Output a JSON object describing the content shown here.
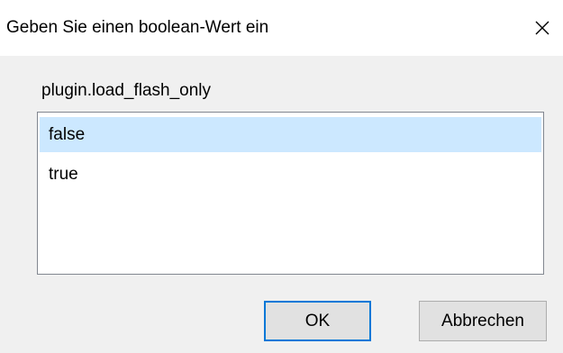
{
  "window": {
    "title": "Geben Sie einen boolean-Wert ein",
    "close_icon": "close-icon"
  },
  "prompt": {
    "label": "plugin.load_flash_only"
  },
  "list": {
    "items": [
      {
        "label": "false",
        "selected": true
      },
      {
        "label": "true",
        "selected": false
      }
    ]
  },
  "buttons": {
    "ok_label": "OK",
    "cancel_label": "Abbrechen"
  },
  "colors": {
    "selection": "#cce8ff",
    "default_button_border": "#0078d7",
    "button_face": "#e1e1e1",
    "dialog_background": "#f0f0f0"
  }
}
